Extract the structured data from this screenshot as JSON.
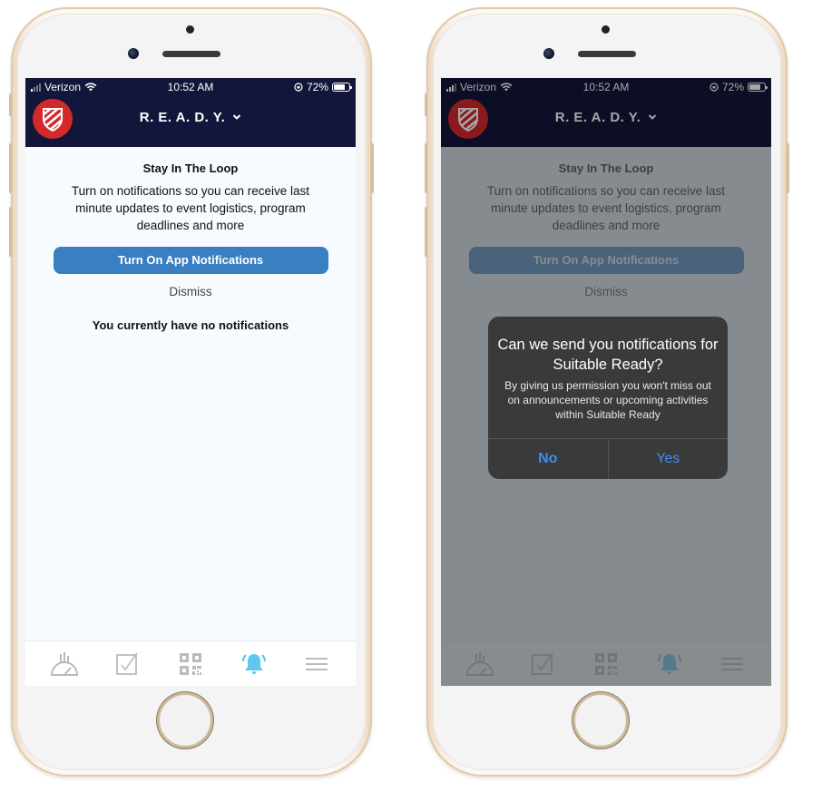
{
  "phones": [
    {
      "id": "left",
      "status_bar": {
        "carrier": "Verizon",
        "time": "10:52 AM",
        "battery": "72%",
        "battery_level": 0.72
      },
      "navbar": {
        "title": "R. E. A. D. Y."
      },
      "content": {
        "title": "Stay In The Loop",
        "body": "Turn on notifications so you can receive last minute updates to event logistics, program deadlines and more",
        "primary_button": "Turn On App Notifications",
        "dismiss": "Dismiss",
        "empty_state": "You currently have no notifications"
      }
    },
    {
      "id": "right",
      "status_bar": {
        "carrier": "Verizon",
        "time": "10:52 AM",
        "battery": "72%",
        "battery_level": 0.72
      },
      "navbar": {
        "title": "R. E. A. D. Y."
      },
      "content": {
        "title": "Stay In The Loop",
        "body": "Turn on notifications so you can receive last minute updates to event logistics, program deadlines and more",
        "primary_button": "Turn On App Notifications",
        "dismiss": "Dismiss"
      },
      "alert": {
        "title": "Can we send you notifications for Suitable Ready?",
        "message": "By giving us permission you won't miss out on announcements or upcoming activities within Suitable Ready",
        "no": "No",
        "yes": "Yes"
      }
    }
  ],
  "tabs": [
    {
      "icon": "dashboard-gauge-icon",
      "active": false
    },
    {
      "icon": "checkbox-icon",
      "active": false
    },
    {
      "icon": "qr-code-icon",
      "active": false
    },
    {
      "icon": "bell-icon",
      "active": true
    },
    {
      "icon": "menu-icon",
      "active": false
    }
  ],
  "colors": {
    "navbar": "#12163a",
    "primary_button": "#3a7fc1",
    "logo": "#d4292b",
    "active_tab": "#5ec8f2",
    "inactive_tab": "#b8bcc0",
    "alert_button": "#3d8ef0"
  }
}
